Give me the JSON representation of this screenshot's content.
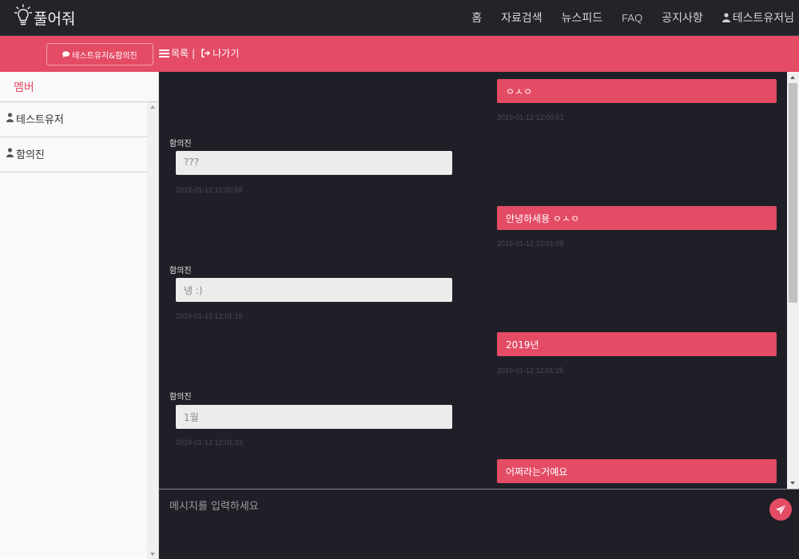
{
  "navbar": {
    "logo_text": "풀어줘",
    "items": [
      "홈",
      "자료검색",
      "뉴스피드",
      "FAQ",
      "공지사항"
    ],
    "user_label": "테스트유저님"
  },
  "subbar": {
    "room_name": "테스트유저&함의진",
    "list_label": "목록",
    "separator": "|",
    "exit_label": "나가기"
  },
  "sidebar": {
    "title": "멤버",
    "members": [
      "테스트유저",
      "함의진"
    ]
  },
  "messages": [
    {
      "mine": true,
      "text": "ㅇㅅㅇ",
      "time": "2019-01-12 12:00:51"
    },
    {
      "mine": false,
      "sender": "함의진",
      "text": "???",
      "time": "2019-01-12 12:00:58"
    },
    {
      "mine": true,
      "text": "안녕하세용 ㅇㅅㅇ",
      "time": "2019-01-12 12:01:08"
    },
    {
      "mine": false,
      "sender": "함의진",
      "text": "넹 :)",
      "time": "2019-01-12 12:01:15"
    },
    {
      "mine": true,
      "text": "2019년",
      "time": "2019-01-12 12:01:25"
    },
    {
      "mine": false,
      "sender": "함의진",
      "text": "1월",
      "time": "2019-01-12 12:01:33"
    },
    {
      "mine": true,
      "text": "어쩌라는거예요",
      "time": ""
    }
  ],
  "input": {
    "placeholder": "메시지를 입력하세요",
    "value": ""
  },
  "colors": {
    "accent": "#e44b65",
    "navbar_bg": "#232429",
    "chat_bg": "#1e1f27",
    "other_bubble": "#ececec"
  }
}
